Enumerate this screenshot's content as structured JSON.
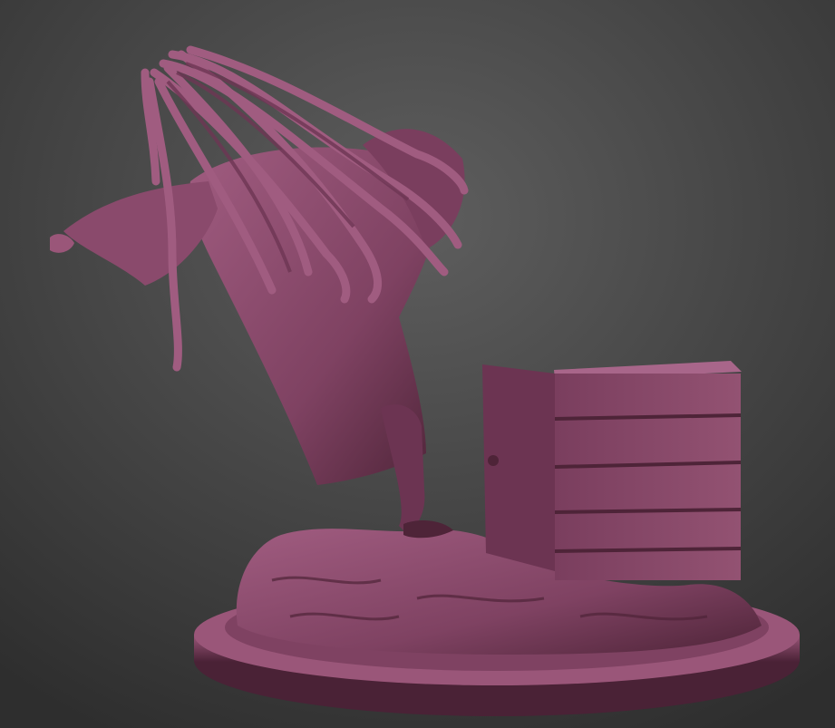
{
  "scene": {
    "subject": "sculpt-render",
    "colors": {
      "background_top": "#5c5c5c",
      "background_bottom": "#2f2f2f",
      "material_light": "#9a5679",
      "material_mid": "#7f4262",
      "material_dark": "#4e2438",
      "material_shadow": "#3a1a2a"
    }
  }
}
